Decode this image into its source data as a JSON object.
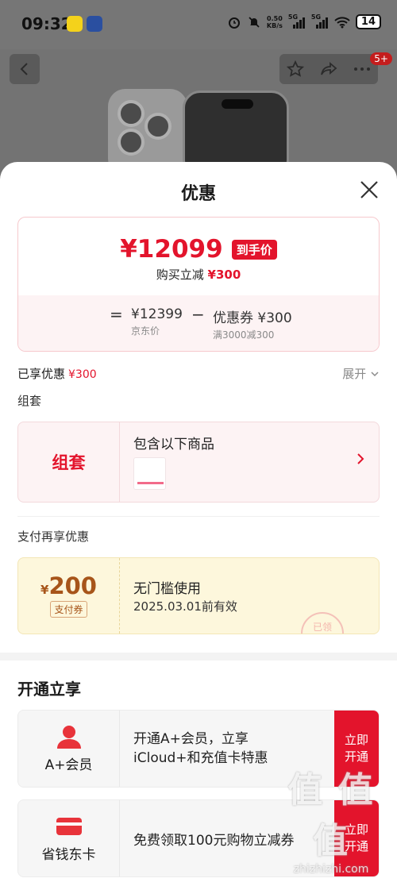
{
  "status_bar": {
    "time": "09:32",
    "net_speed_value": "0.50",
    "net_speed_unit": "KB/s",
    "sim1": "5G",
    "sim2": "5G",
    "battery": "14"
  },
  "header": {
    "notification_badge": "5+"
  },
  "sheet": {
    "title": "优惠"
  },
  "price": {
    "final_price": "¥12099",
    "final_tag": "到手价",
    "discount_text": "购买立减",
    "discount_amount": "¥300",
    "equals": "=",
    "base_value": "¥12399",
    "base_label": "京东价",
    "minus": "−",
    "coupon_value": "优惠券 ¥300",
    "coupon_label": "满3000减300"
  },
  "enjoyed": {
    "label": "已享优惠",
    "amount": "¥300",
    "expand_label": "展开"
  },
  "bundle": {
    "section_label": "组套",
    "card_label": "组套",
    "title": "包含以下商品"
  },
  "payment": {
    "section_label": "支付再享优惠",
    "coupon_currency": "¥",
    "coupon_amount": "200",
    "coupon_tag": "支付券",
    "coupon_title": "无门槛使用",
    "coupon_validity": "2025.03.01前有效",
    "stamp_text": "已领"
  },
  "open_section": {
    "title": "开通立享",
    "cards": [
      {
        "name": "A+会员",
        "line1": "开通A+会员，立享",
        "line2": "iCloud+和充值卡特惠",
        "btn_line1": "立即",
        "btn_line2": "开通"
      },
      {
        "name": "省钱东卡",
        "desc": "免费领取100元购物立减券",
        "btn_line1": "立即",
        "btn_line2": "开通"
      }
    ]
  },
  "watermark": {
    "logo": "值 值 值",
    "url": "zhizhizhi.com"
  },
  "colors": {
    "accent_red": "#e3142c",
    "coupon_brown": "#a7551a",
    "coupon_bg": "#fdf7dc"
  }
}
